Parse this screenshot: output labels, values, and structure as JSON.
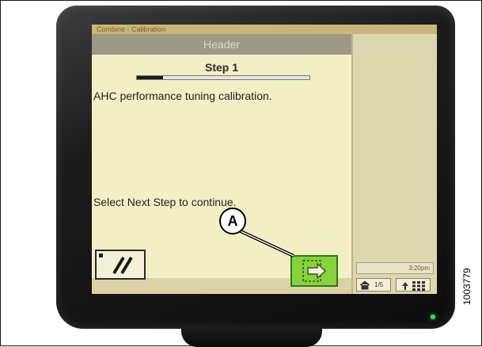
{
  "screen": {
    "breadcrumb": "Combine - Calibration",
    "header_title": "Header",
    "step_title": "Step 1",
    "progress": 0.15,
    "description": "AHC performance tuning calibration.",
    "instruction": "Select Next Step to continue."
  },
  "buttons": {
    "cancel_icon": "cancel-slash-icon",
    "next_icon": "next-step-icon"
  },
  "side_panel": {
    "time": "3:20pm",
    "home_label": "1/5",
    "home_icon": "home-icon",
    "grid_icon": "menu-grid-icon"
  },
  "callout": {
    "label": "A"
  },
  "figure_id": "1003779",
  "colors": {
    "screen_bg": "#f3efc5",
    "header_bar": "#9c9a86",
    "next_button": "#88d23a",
    "led": "#27e04a"
  }
}
